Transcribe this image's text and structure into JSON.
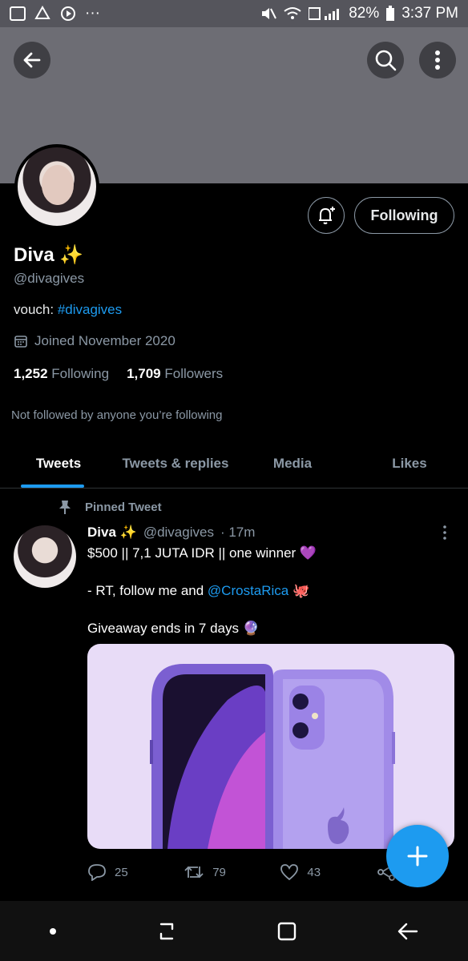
{
  "status_bar": {
    "battery": "82%",
    "time": "3:37 PM",
    "overflow": "···"
  },
  "profile": {
    "name": "Diva ✨",
    "handle": "@divagives",
    "bio_prefix": "vouch: ",
    "bio_hashtag": "#divagives",
    "joined": "Joined November 2020",
    "following_count": "1,252",
    "following_label": "Following",
    "followers_count": "1,709",
    "followers_label": "Followers",
    "not_followed": "Not followed by anyone you’re following",
    "follow_button": "Following"
  },
  "tabs": [
    {
      "label": "Tweets",
      "active": true
    },
    {
      "label": "Tweets & replies",
      "active": false
    },
    {
      "label": "Media",
      "active": false
    },
    {
      "label": "Likes",
      "active": false
    }
  ],
  "tweet": {
    "pinned_label": "Pinned Tweet",
    "author_name": "Diva ✨",
    "author_handle": "@divagives",
    "time": "· 17m",
    "line1": "$500 || 7,1 JUTA IDR || one winner 💜",
    "line2_prefix": "- RT, follow me and ",
    "line2_mention": "@CrostaRica",
    "line2_suffix": " 🐙",
    "line3": "Giveaway ends in 7 days 🔮",
    "replies": "25",
    "retweets": "79",
    "likes": "43"
  },
  "colors": {
    "accent": "#1d9bf0",
    "secondary_text": "#8b98a5",
    "background": "#000000",
    "banner": "#6d6d74"
  },
  "icons": {
    "back": "arrow-left-icon",
    "search": "search-icon",
    "more": "more-vertical-icon",
    "notify": "bell-plus-icon",
    "calendar": "calendar-icon",
    "pin": "pin-icon",
    "reply": "reply-icon",
    "retweet": "retweet-icon",
    "like": "heart-icon",
    "share": "share-icon",
    "compose": "plus-icon"
  }
}
